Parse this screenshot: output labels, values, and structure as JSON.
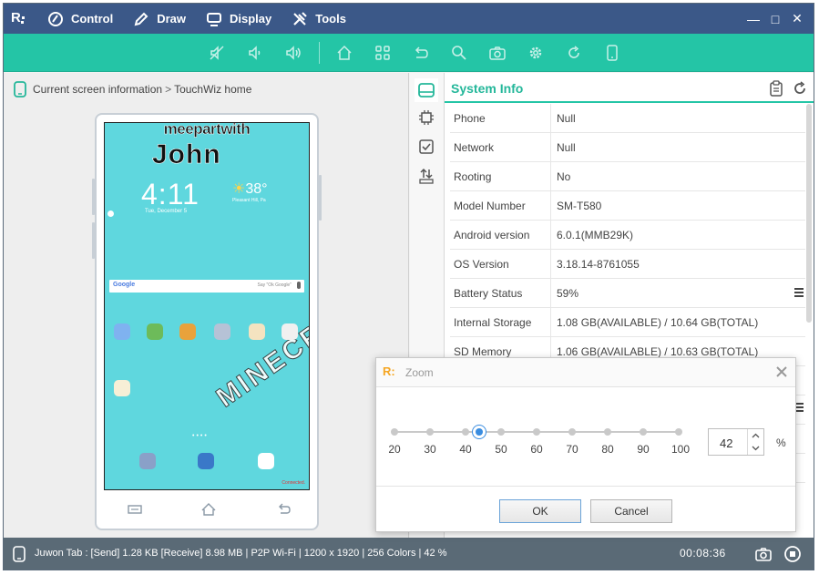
{
  "menu": {
    "items": [
      {
        "label": "Control",
        "icon": "control-icon"
      },
      {
        "label": "Draw",
        "icon": "pen-icon"
      },
      {
        "label": "Display",
        "icon": "monitor-icon"
      },
      {
        "label": "Tools",
        "icon": "tools-icon"
      }
    ]
  },
  "toolbar": {
    "icons": [
      "mute-icon",
      "volume-down-icon",
      "volume-up-icon",
      "home-icon",
      "apps-icon",
      "back-icon",
      "search-icon",
      "camera-icon",
      "settings-icon",
      "rotate-icon",
      "phone-icon"
    ]
  },
  "breadcrumb": {
    "label": "Current screen information",
    "separator": ">",
    "current": "TouchWiz home"
  },
  "device_screen": {
    "banner_top": "meepartwith",
    "banner_name": "John",
    "clock": "4:11",
    "date": "Tue, December 5",
    "temperature": "38°",
    "weather_location": "Pleasant Hill, Pa",
    "google_logo": "Google",
    "google_hint": "Say \"Ok Google\"",
    "overlay_word": "MINECRAFT",
    "connected": "Connected."
  },
  "system_info": {
    "title": "System Info",
    "rows": [
      {
        "key": "Phone",
        "value": "Null"
      },
      {
        "key": "Network",
        "value": "Null"
      },
      {
        "key": "Rooting",
        "value": "No"
      },
      {
        "key": "Model Number",
        "value": "SM-T580"
      },
      {
        "key": "Android version",
        "value": "6.0.1(MMB29K)"
      },
      {
        "key": "OS Version",
        "value": "3.18.14-8761055"
      },
      {
        "key": "Battery Status",
        "value": "59%"
      },
      {
        "key": "Internal Storage",
        "value": "1.08 GB(AVAILABLE) / 10.64 GB(TOTAL)"
      },
      {
        "key": "SD Memory",
        "value": "1.06 GB(AVAILABLE) / 10.63 GB(TOTAL)"
      }
    ]
  },
  "status": {
    "text": "Juwon Tab : [Send] 1.28 KB  [Receive] 8.98 MB | P2P Wi-Fi | 1200 x 1920 | 256 Colors | 42 %",
    "time": "00:08:36"
  },
  "zoom_dialog": {
    "title": "Zoom",
    "ticks": [
      "20",
      "30",
      "40",
      "50",
      "60",
      "70",
      "80",
      "90",
      "100"
    ],
    "value": "42",
    "percent_label": "%",
    "ok_label": "OK",
    "cancel_label": "Cancel"
  },
  "colors": {
    "titlebar": "#3b5888",
    "toolbar": "#24c5a6",
    "accent": "#24b79a",
    "statusbar": "#5a6a76",
    "slider": "#3a8de0"
  }
}
